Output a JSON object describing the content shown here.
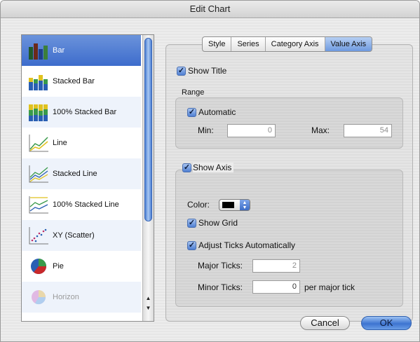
{
  "window": {
    "title": "Edit Chart"
  },
  "chart_types": [
    {
      "label": "Bar",
      "icon": "bar-chart-icon",
      "selected": true
    },
    {
      "label": "Stacked Bar",
      "icon": "stacked-bar-chart-icon"
    },
    {
      "label": "100% Stacked Bar",
      "icon": "percent-stacked-bar-chart-icon"
    },
    {
      "label": "Line",
      "icon": "line-chart-icon"
    },
    {
      "label": "Stacked Line",
      "icon": "stacked-line-chart-icon"
    },
    {
      "label": "100% Stacked Line",
      "icon": "percent-stacked-line-chart-icon"
    },
    {
      "label": "XY (Scatter)",
      "icon": "scatter-chart-icon"
    },
    {
      "label": "Pie",
      "icon": "pie-chart-icon"
    },
    {
      "label": "Horizon",
      "icon": "horizon-chart-icon",
      "disabled": true
    }
  ],
  "tabs": [
    {
      "label": "Style"
    },
    {
      "label": "Series"
    },
    {
      "label": "Category Axis"
    },
    {
      "label": "Value Axis",
      "active": true
    }
  ],
  "value_axis": {
    "show_title_label": "Show Title",
    "show_title_checked": true,
    "range_label": "Range",
    "automatic_label": "Automatic",
    "automatic_checked": true,
    "min_label": "Min:",
    "min_value": "0",
    "max_label": "Max:",
    "max_value": "54",
    "show_axis_label": "Show Axis",
    "show_axis_checked": true,
    "color_label": "Color:",
    "axis_color": "#000000",
    "show_grid_label": "Show Grid",
    "show_grid_checked": true,
    "adjust_ticks_label": "Adjust Ticks Automatically",
    "adjust_ticks_checked": true,
    "major_ticks_label": "Major Ticks:",
    "major_ticks_value": "2",
    "minor_ticks_label": "Minor Ticks:",
    "minor_ticks_value": "0",
    "per_major_tick_label": "per major tick"
  },
  "buttons": {
    "cancel": "Cancel",
    "ok": "OK"
  },
  "colors": {
    "selection": "#3d6ccc",
    "accent": "#4f7fd2"
  }
}
